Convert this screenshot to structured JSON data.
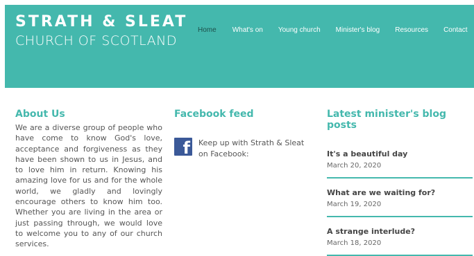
{
  "brand": {
    "line1": "STRATH & SLEAT",
    "line2": "CHURCH OF SCOTLAND"
  },
  "nav": [
    {
      "label": "Home",
      "active": true
    },
    {
      "label": "What's on"
    },
    {
      "label": "Young church"
    },
    {
      "label": "Minister's blog"
    },
    {
      "label": "Resources"
    },
    {
      "label": "Contact"
    }
  ],
  "about": {
    "title": "About Us",
    "text": "We are a diverse group of people who have come to know God's love, acceptance and forgiveness as they have been shown to us in Jesus, and to love him in return. Knowing his amazing love for us and for the whole world, we gladly and lovingly encourage others to know him too. Whether you are living in the area or just passing through, we would love to welcome you to any of our church services."
  },
  "facebook": {
    "title": "Facebook feed",
    "icon": "facebook-icon",
    "text": "Keep up with Strath & Sleat on Facebook:"
  },
  "blog": {
    "title": "Latest minister's blog posts",
    "posts": [
      {
        "title": "It's a beautiful day",
        "date": "March 20, 2020"
      },
      {
        "title": "What are we waiting for?",
        "date": "March 19, 2020"
      },
      {
        "title": "A strange interlude?",
        "date": "March 18, 2020"
      }
    ]
  },
  "colors": {
    "accent": "#44b8ad",
    "facebook": "#3b5998"
  }
}
